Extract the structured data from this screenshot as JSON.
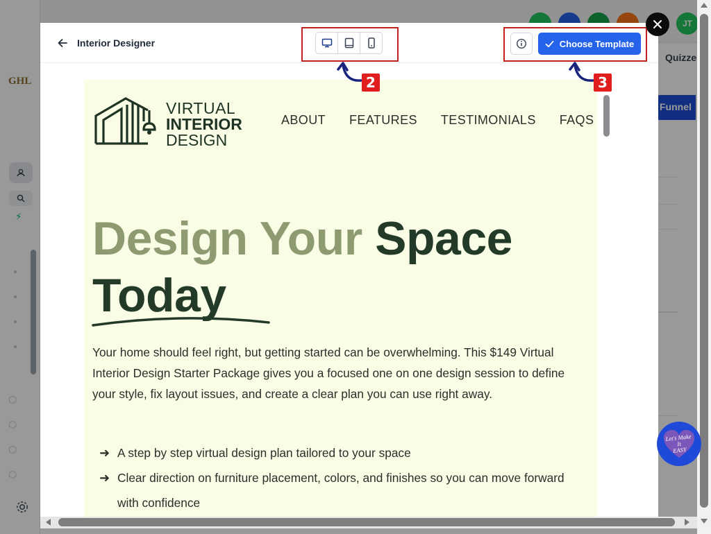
{
  "background": {
    "brand": "GHL",
    "tab_label": "Quizze",
    "funnel_label": "Funnel"
  },
  "modal": {
    "title": "Interior Designer",
    "devices": [
      "desktop-icon",
      "tablet-icon",
      "mobile-icon"
    ],
    "choose_label": "Choose Template"
  },
  "preview": {
    "logo": {
      "line1": "VIRTUAL",
      "line2": "INTERIOR",
      "line3": "DESIGN"
    },
    "nav": [
      "ABOUT",
      "FEATURES",
      "TESTIMONIALS",
      "FAQS"
    ],
    "hero": {
      "title_part1": "Design Your",
      "title_part2": "Space",
      "title_line2": "Today"
    },
    "description": "Your home should feel right, but getting started can be overwhelming. This $149 Virtual Interior Design Starter Package gives you a focused one on one design session to define your style, fix layout issues, and create a clear plan you can use right away.",
    "bullets": [
      "A step by step virtual design plan tailored to your space",
      "Clear direction on furniture placement, colors, and finishes so you can move forward with confidence"
    ]
  },
  "annotations": {
    "device_switcher": "2",
    "choose_template": "3"
  },
  "badge": {
    "line1": "Let's Make",
    "line2": "It",
    "line3": "EASY"
  },
  "colors": {
    "primary": "#2563eb",
    "annotation": "#e01e1e",
    "preview_bg": "#f9fde6",
    "hero_dark": "#233a28",
    "hero_muted": "#8e9a70"
  }
}
